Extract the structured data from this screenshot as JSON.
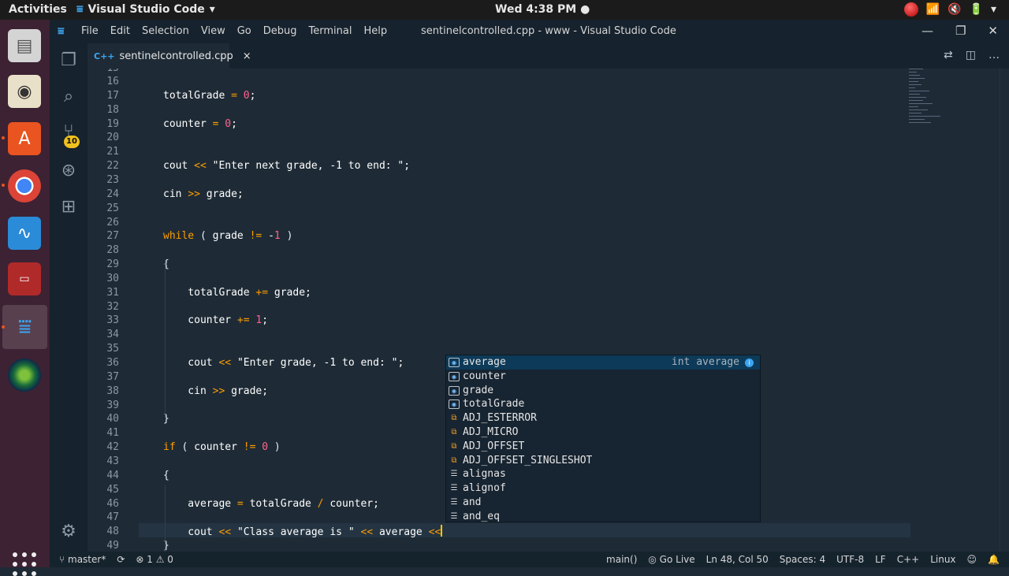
{
  "topbar": {
    "activities": "Activities",
    "app_name": "Visual Studio Code",
    "app_arrow": "▾",
    "clock": "Wed  4:38 PM ●",
    "tray": [
      "📶",
      "🔇",
      "🔋",
      "▾"
    ]
  },
  "dock": {
    "items": [
      "files-app",
      "speaker-app",
      "software-center",
      "chrome",
      "system-monitor",
      "terminal",
      "vscode",
      "globe-app"
    ]
  },
  "titlebar": {
    "logo": "⩸",
    "menu": [
      "File",
      "Edit",
      "Selection",
      "View",
      "Go",
      "Debug",
      "Terminal",
      "Help"
    ],
    "title": "sentinelcontrolled.cpp - www - Visual Studio Code",
    "controls": [
      "—",
      "❐",
      "✕"
    ]
  },
  "activitybar": {
    "scm_badge": "10"
  },
  "tab": {
    "lang_icon": "C++",
    "filename": "sentinelcontrolled.cpp",
    "close": "×"
  },
  "editor": {
    "top_partial_line": "15",
    "lines": [
      {
        "n": "16",
        "code": ""
      },
      {
        "n": "17",
        "code": "totalGrade = 0;"
      },
      {
        "n": "18",
        "code": ""
      },
      {
        "n": "19",
        "code": "counter = 0;"
      },
      {
        "n": "20",
        "code": ""
      },
      {
        "n": "21",
        "code": ""
      },
      {
        "n": "22",
        "code": "cout << \"Enter next grade, -1 to end: \";"
      },
      {
        "n": "23",
        "code": ""
      },
      {
        "n": "24",
        "code": "cin >> grade;"
      },
      {
        "n": "25",
        "code": ""
      },
      {
        "n": "26",
        "code": ""
      },
      {
        "n": "27",
        "code": "while ( grade != -1 )"
      },
      {
        "n": "28",
        "code": ""
      },
      {
        "n": "29",
        "code": "{"
      },
      {
        "n": "30",
        "code": ""
      },
      {
        "n": "31",
        "code": "    totalGrade += grade;"
      },
      {
        "n": "32",
        "code": ""
      },
      {
        "n": "33",
        "code": "    counter += 1;"
      },
      {
        "n": "34",
        "code": ""
      },
      {
        "n": "35",
        "code": ""
      },
      {
        "n": "36",
        "code": "    cout << \"Enter grade, -1 to end: \";"
      },
      {
        "n": "37",
        "code": ""
      },
      {
        "n": "38",
        "code": "    cin >> grade;"
      },
      {
        "n": "39",
        "code": ""
      },
      {
        "n": "40",
        "code": "}"
      },
      {
        "n": "41",
        "code": ""
      },
      {
        "n": "42",
        "code": "if ( counter != 0 )"
      },
      {
        "n": "43",
        "code": ""
      },
      {
        "n": "44",
        "code": "{"
      },
      {
        "n": "45",
        "code": ""
      },
      {
        "n": "46",
        "code": "    average = totalGrade / counter;"
      },
      {
        "n": "47",
        "code": ""
      },
      {
        "n": "48",
        "code": "    cout << \"Class average is \" << average <<"
      },
      {
        "n": "49",
        "code": "}"
      }
    ]
  },
  "suggest": {
    "items": [
      {
        "label": "average",
        "kind": "var",
        "detail": "int average",
        "selected": true
      },
      {
        "label": "counter",
        "kind": "var"
      },
      {
        "label": "grade",
        "kind": "var"
      },
      {
        "label": "totalGrade",
        "kind": "var"
      },
      {
        "label": "ADJ_ESTERROR",
        "kind": "mac"
      },
      {
        "label": "ADJ_MICRO",
        "kind": "mac"
      },
      {
        "label": "ADJ_OFFSET",
        "kind": "mac"
      },
      {
        "label": "ADJ_OFFSET_SINGLESHOT",
        "kind": "mac"
      },
      {
        "label": "alignas",
        "kind": "kwd"
      },
      {
        "label": "alignof",
        "kind": "kwd"
      },
      {
        "label": "and",
        "kind": "kwd"
      },
      {
        "label": "and_eq",
        "kind": "kwd"
      }
    ]
  },
  "statusbar": {
    "branch": "⑂ master*",
    "sync": "⟳",
    "problems": "⊗ 1 ⚠ 0",
    "function": "main()",
    "golive": "◎ Go Live",
    "position": "Ln 48, Col 50",
    "spaces": "Spaces: 4",
    "encoding": "UTF-8",
    "eol": "LF",
    "language": "C++",
    "os": "Linux",
    "smiley": "☺",
    "bell": "🔔"
  },
  "colors": {
    "editor_bg": "#1e2b36",
    "keyword": "#ff9d00",
    "number": "#ff628c",
    "cursor": "#ffc600"
  }
}
